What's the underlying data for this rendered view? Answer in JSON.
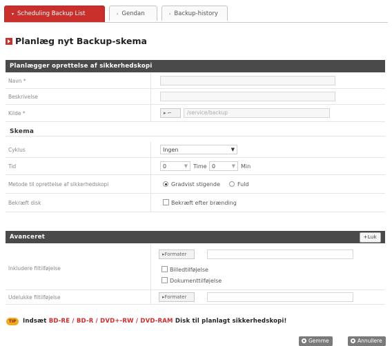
{
  "tabs": [
    {
      "label": "Scheduling Backup List",
      "caret": "▾"
    },
    {
      "label": "Gendan",
      "caret": "›"
    },
    {
      "label": "Backup-history",
      "caret": "›"
    }
  ],
  "page_title": "Planlæg nyt Backup-skema",
  "panel1": {
    "header": "Planlægger oprettelse af sikkerhedskopi",
    "name_label": "Navn *",
    "desc_label": "Beskrivelse",
    "source_label": "Kilde *",
    "source_button": "▸ ⌐",
    "source_path": "/service/backup"
  },
  "schedule": {
    "section": "Skema",
    "cycle_label": "Cyklus",
    "cycle_value": "Ingen",
    "time_label": "Tid",
    "hour_value": "0",
    "hour_unit": "Time",
    "min_value": "0",
    "min_unit": "Min",
    "method_label": "Metode til oprettelse af sikkerhedskopi",
    "method_option1": "Gradvist stigende",
    "method_option2": "Fuld",
    "confirm_label": "Bekræft disk",
    "confirm_option": "Bekræft efter brænding"
  },
  "advanced": {
    "header": "Avanceret",
    "close_button": "+Luk",
    "include_label": "Inkludere filtilføjelse",
    "format_button": "▸Formater",
    "image_ext": "Billedtilføjelse",
    "doc_ext": "Dokumenttilføjelse",
    "exclude_label": "Udelukke filtilføjelse",
    "format_button2": "▸Formater"
  },
  "tip": {
    "badge": "TIP",
    "prefix": "Indsæt ",
    "media": "BD-RE / BD-R / DVD+-RW / DVD-RAM",
    "suffix": " Disk til planlagt sikkerhedskopi!"
  },
  "actions": {
    "save": "Gemme",
    "cancel": "Annullere"
  },
  "colors": {
    "accent": "#c9302c",
    "header_bg": "#4a4a4a",
    "tip": "#f5a91c"
  }
}
